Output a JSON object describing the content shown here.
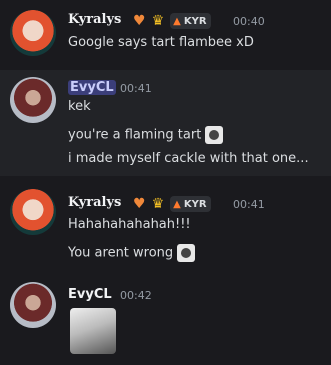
{
  "messages": [
    {
      "author": "Kyralys",
      "time": "00:40",
      "tag": "KYR",
      "lines": [
        "Google says tart flambee xD"
      ]
    },
    {
      "author": "EvyCL",
      "time": "00:41",
      "lines": [
        "kek",
        "you're a flaming tart",
        "i made myself cackle with that one..."
      ]
    },
    {
      "author": "Kyralys",
      "time": "00:41",
      "tag": "KYR",
      "lines": [
        "Hahahahahahah!!!",
        "You arent wrong"
      ]
    },
    {
      "author": "EvyCL",
      "time": "00:42",
      "lines": []
    }
  ],
  "icons": {
    "heart": "orange-heart-icon",
    "crown": "crown-icon",
    "tag_flame": "flame-icon"
  },
  "colors": {
    "background": "#1a1a1e",
    "hover_background": "#222327",
    "name_highlight": "#3b3e7a",
    "timestamp": "#949ba4",
    "text": "#dbdee1"
  }
}
